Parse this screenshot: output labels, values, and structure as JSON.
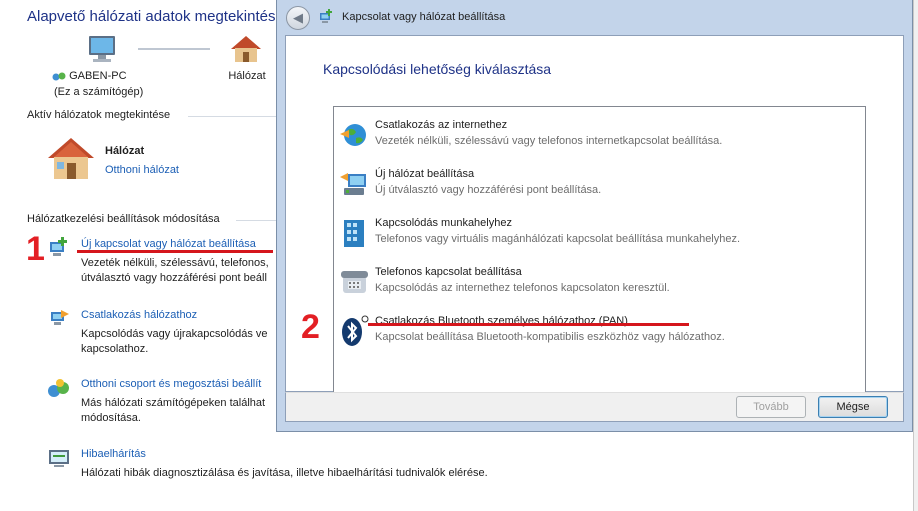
{
  "background": {
    "title": "Alapvető hálózati adatok megtekintése",
    "map": {
      "computer_name": "GABEN-PC",
      "computer_sub": "(Ez a számítógép)",
      "network": "Hálózat"
    },
    "active_networks_heading": "Aktív hálózatok megtekintése",
    "network_name": "Hálózat",
    "network_type": "Otthoni hálózat",
    "change_settings_heading": "Hálózatkezelési beállítások módosítása",
    "tasks": [
      {
        "link": "Új kapcsolat vagy hálózat beállítása",
        "desc1": "Vezeték nélküli, szélessávú, telefonos,",
        "desc2": "útválasztó vagy hozzáférési pont beáll"
      },
      {
        "link": "Csatlakozás hálózathoz",
        "desc1": "Kapcsolódás vagy újrakapcsolódás ve",
        "desc2": "kapcsolathoz."
      },
      {
        "link": "Otthoni csoport és megosztási beállít",
        "desc1": "Más hálózati számítógépeken találhat",
        "desc2": "módosítása."
      },
      {
        "link": "Hibaelhárítás",
        "desc1": "Hálózati hibák diagnosztizálása és javítása, illetve hibaelhárítási tudnivalók elérése.",
        "desc2": ""
      }
    ]
  },
  "annotations": {
    "one": "1",
    "two": "2"
  },
  "dialog": {
    "title": "Kapcsolat vagy hálózat beállítása",
    "heading": "Kapcsolódási lehetőség kiválasztása",
    "options": [
      {
        "title": "Csatlakozás az internethez",
        "desc": "Vezeték nélküli, szélessávú vagy telefonos internetkapcsolat beállítása."
      },
      {
        "title": "Új hálózat beállítása",
        "desc": "Új útválasztó vagy hozzáférési pont beállítása."
      },
      {
        "title": "Kapcsolódás munkahelyhez",
        "desc": "Telefonos vagy virtuális magánhálózati kapcsolat beállítása munkahelyhez."
      },
      {
        "title": "Telefonos kapcsolat beállítása",
        "desc": "Kapcsolódás az internethez telefonos kapcsolaton keresztül."
      },
      {
        "title": "Csatlakozás Bluetooth személyes hálózathoz (PAN)",
        "desc": "Kapcsolat beállítása Bluetooth-kompatibilis eszközhöz vagy hálózathoz."
      }
    ],
    "buttons": {
      "next": "Tovább",
      "cancel": "Mégse"
    },
    "back_glyph": "◀"
  }
}
